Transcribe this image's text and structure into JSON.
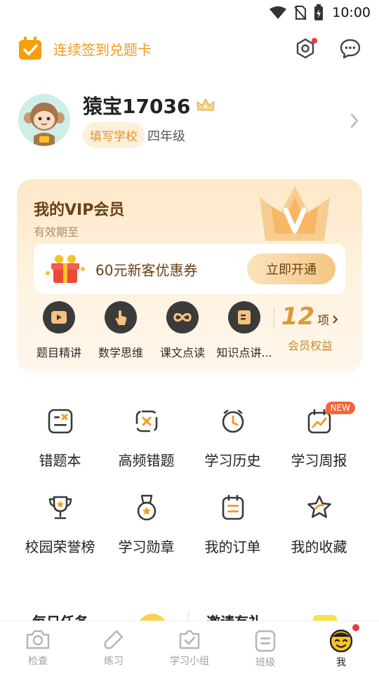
{
  "status_bar": {
    "time": "10:00"
  },
  "header": {
    "checkin_label": "连续签到兑题卡"
  },
  "profile": {
    "username": "猿宝17036",
    "school_button": "填写学校",
    "grade": "四年级"
  },
  "vip": {
    "title": "我的VIP会员",
    "subtitle": "有效期至",
    "coupon_text": "60元新客优惠券",
    "open_button": "立即开通",
    "features": [
      {
        "label": "题目精讲",
        "icon": "video-play-icon"
      },
      {
        "label": "数学思维",
        "icon": "hand-touch-icon"
      },
      {
        "label": "课文点读",
        "icon": "infinity-icon"
      },
      {
        "label": "知识点讲...",
        "icon": "book-icon"
      }
    ],
    "more_count": "12",
    "more_unit": "项",
    "more_label": "会员权益"
  },
  "tools": [
    {
      "label": "错题本",
      "icon": "wrong-book-icon"
    },
    {
      "label": "高频错题",
      "icon": "frequent-mistakes-icon"
    },
    {
      "label": "学习历史",
      "icon": "clock-icon"
    },
    {
      "label": "学习周报",
      "icon": "weekly-report-icon",
      "badge": "NEW"
    },
    {
      "label": "校园荣誉榜",
      "icon": "trophy-icon"
    },
    {
      "label": "学习勋章",
      "icon": "medal-icon"
    },
    {
      "label": "我的订单",
      "icon": "order-icon"
    },
    {
      "label": "我的收藏",
      "icon": "star-icon"
    }
  ],
  "bottom_strip": {
    "left": "每日任务",
    "right": "邀请有礼"
  },
  "tabbar": [
    {
      "label": "检查",
      "icon": "camera-icon"
    },
    {
      "label": "练习",
      "icon": "pencil-icon"
    },
    {
      "label": "学习小组",
      "icon": "group-check-icon"
    },
    {
      "label": "班级",
      "icon": "class-icon"
    },
    {
      "label": "我",
      "icon": "face-icon",
      "active": true
    }
  ],
  "colors": {
    "accent": "#f39a1e",
    "vip_brown": "#6b3f16",
    "badge_red": "#f2643a"
  }
}
